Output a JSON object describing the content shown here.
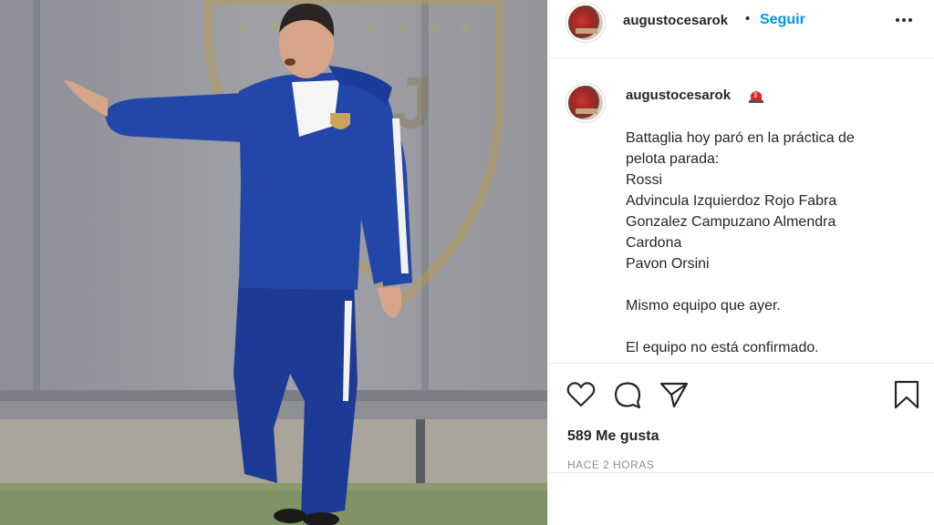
{
  "post": {
    "username": "augustocesarok",
    "follow_label": "Seguir",
    "separator": "•",
    "caption_lines": [
      "Battaglia hoy paró en la práctica de",
      "pelota parada:",
      "Rossi",
      "Advincula Izquierdoz Rojo Fabra",
      "Gonzalez Campuzano Almendra",
      "Cardona",
      "Pavon Orsini",
      "",
      "Mismo equipo que ayer.",
      "",
      "El equipo no está confirmado."
    ],
    "likes": "589 Me gusta",
    "timestamp": "HACE 2 HORAS"
  },
  "icons": {
    "more": "more-options-icon",
    "siren": "siren-emoji-icon",
    "like": "heart-icon",
    "comment": "comment-icon",
    "share": "paper-plane-icon",
    "save": "bookmark-icon"
  },
  "colors": {
    "link_blue": "#0095f6",
    "text": "#262626",
    "muted": "#8e8e8e",
    "jacket_blue": "#1f3f9e",
    "crest_gold": "#c9a55a"
  }
}
